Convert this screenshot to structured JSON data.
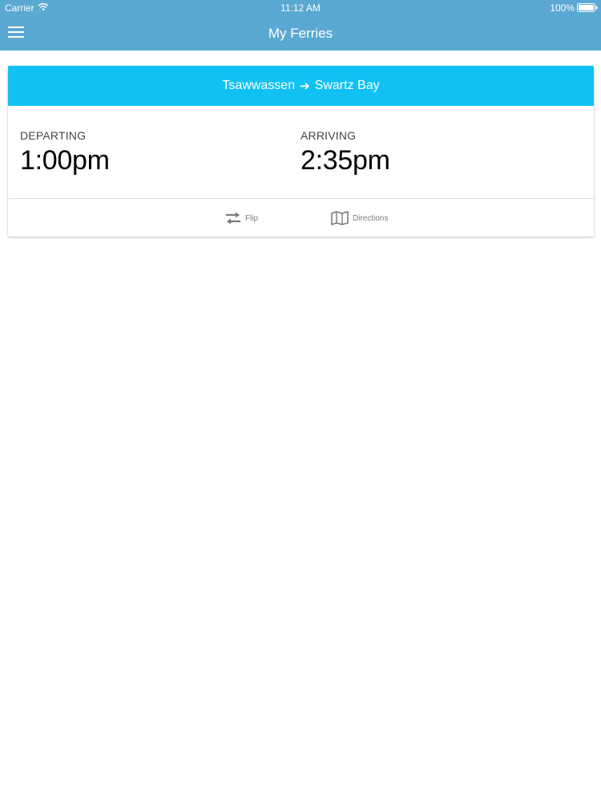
{
  "status_bar": {
    "carrier": "Carrier",
    "time": "11:12 AM",
    "battery": "100%"
  },
  "nav": {
    "title": "My Ferries",
    "menu_icon": "hamburger-menu-icon"
  },
  "ferry_card": {
    "origin": "Tsawwassen",
    "arrow": "➔",
    "destination": "Swartz Bay",
    "departing_label": "DEPARTING",
    "departing_time": "1:00pm",
    "arriving_label": "ARRIVING",
    "arriving_time": "2:35pm",
    "actions": {
      "flip_label": "Flip",
      "directions_label": "Directions"
    }
  },
  "colors": {
    "nav_bar": "#5aa9d2",
    "card_header": "#12c1f3",
    "icon_gray": "#7a7a7a"
  }
}
